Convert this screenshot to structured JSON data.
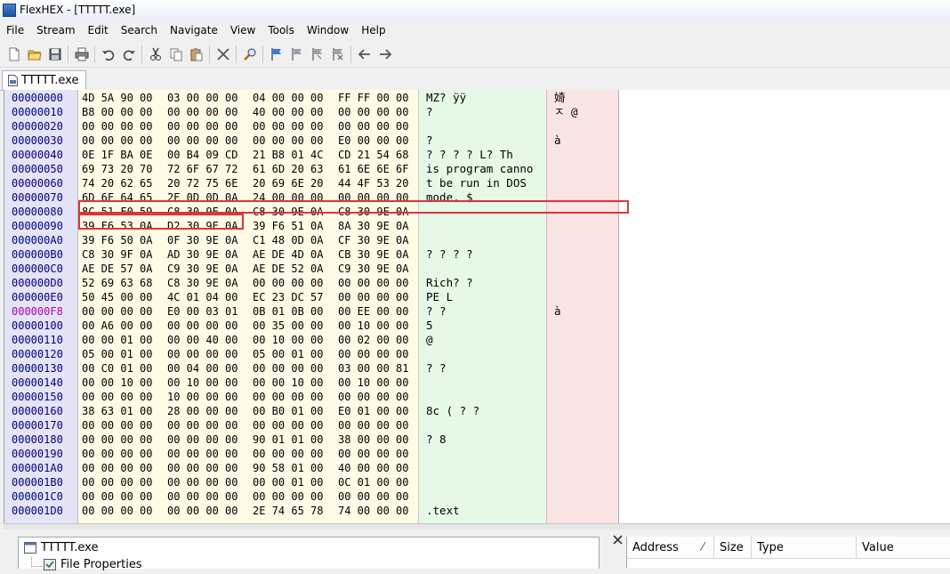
{
  "window": {
    "title": "FlexHEX - [TTTTT.exe]"
  },
  "menu": [
    "File",
    "Stream",
    "Edit",
    "Search",
    "Navigate",
    "View",
    "Tools",
    "Window",
    "Help"
  ],
  "toolbar_icons": [
    "new-file-icon",
    "open-folder-icon",
    "save-icon",
    "sep",
    "print-icon",
    "sep",
    "undo-icon",
    "redo-icon",
    "sep",
    "cut-icon",
    "copy-icon",
    "paste-icon",
    "sep",
    "delete-icon",
    "sep",
    "find-icon",
    "sep",
    "bookmark-flag-icon",
    "bookmark-flag-gray-icon",
    "bookmark-flag-gray-2-icon",
    "bookmark-flag-clear-icon",
    "sep",
    "nav-back-icon",
    "nav-forward-icon"
  ],
  "document_tab": {
    "label": "TTTTT.exe"
  },
  "hex_view": {
    "highlighted_offset": "000000F8",
    "rows": [
      {
        "offset": "00000000",
        "hex": [
          "4D 5A 90 00",
          "03 00 00 00",
          "04 00 00 00",
          "FF FF 00 00"
        ],
        "ascii": "MZ?         ÿÿ",
        "unicode": "婍"
      },
      {
        "offset": "00000010",
        "hex": [
          "B8 00 00 00",
          "00 00 00 00",
          "40 00 00 00",
          "00 00 00 00"
        ],
        "ascii": "?",
        "unicode": "ﾸ    @"
      },
      {
        "offset": "00000020",
        "hex": [
          "00 00 00 00",
          "00 00 00 00",
          "00 00 00 00",
          "00 00 00 00"
        ],
        "ascii": "",
        "unicode": ""
      },
      {
        "offset": "00000030",
        "hex": [
          "00 00 00 00",
          "00 00 00 00",
          "00 00 00 00",
          "E0 00 00 00"
        ],
        "ascii": "            ?",
        "unicode": "      à"
      },
      {
        "offset": "00000040",
        "hex": [
          "0E 1F BA 0E",
          "00 B4 09 CD",
          "21 B8 01 4C",
          "CD 21 54 68"
        ],
        "ascii": "  ? ? ? ? L? Th",
        "unicode": ""
      },
      {
        "offset": "00000050",
        "hex": [
          "69 73 20 70",
          "72 6F 67 72",
          "61 6D 20 63",
          "61 6E 6E 6F"
        ],
        "ascii": "is program canno",
        "unicode": ""
      },
      {
        "offset": "00000060",
        "hex": [
          "74 20 62 65",
          "20 72 75 6E",
          "20 69 6E 20",
          "44 4F 53 20"
        ],
        "ascii": "t be run in DOS",
        "unicode": ""
      },
      {
        "offset": "00000070",
        "hex": [
          "6D 6F 64 65",
          "2E 0D 0D 0A",
          "24 00 00 00",
          "00 00 00 00"
        ],
        "ascii": "mode.   $",
        "unicode": ""
      },
      {
        "offset": "00000080",
        "hex": [
          "8C 51 F0 59",
          "C8 30 9E 0A",
          "C8 30 9E 0A",
          "C8 30 9E 0A"
        ],
        "ascii": "",
        "unicode": ""
      },
      {
        "offset": "00000090",
        "hex": [
          "39 F6 53 0A",
          "D2 30 9E 0A",
          "39 F6 51 0A",
          "8A 30 9E 0A"
        ],
        "ascii": "",
        "unicode": ""
      },
      {
        "offset": "000000A0",
        "hex": [
          "39 F6 50 0A",
          "0F 30 9E 0A",
          "C1 48 0D 0A",
          "CF 30 9E 0A"
        ],
        "ascii": "",
        "unicode": ""
      },
      {
        "offset": "000000B0",
        "hex": [
          "C8 30 9F 0A",
          "AD 30 9E 0A",
          "AE DE 4D 0A",
          "CB 30 9E 0A"
        ],
        "ascii": "? ? ? ?",
        "unicode": ""
      },
      {
        "offset": "000000C0",
        "hex": [
          "AE DE 57 0A",
          "C9 30 9E 0A",
          "AE DE 52 0A",
          "C9 30 9E 0A"
        ],
        "ascii": "",
        "unicode": ""
      },
      {
        "offset": "000000D0",
        "hex": [
          "52 69 63 68",
          "C8 30 9E 0A",
          "00 00 00 00",
          "00 00 00 00"
        ],
        "ascii": "Rich? ?",
        "unicode": ""
      },
      {
        "offset": "000000E0",
        "hex": [
          "50 45 00 00",
          "4C 01 04 00",
          "EC 23 DC 57",
          "00 00 00 00"
        ],
        "ascii": "PE  L",
        "unicode": ""
      },
      {
        "offset": "000000F8",
        "hex": [
          "00 00 00 00",
          "E0 00 03 01",
          "0B 01 0B 00",
          "00 EE 00 00"
        ],
        "ascii": "     ?        ?",
        "unicode": "   à"
      },
      {
        "offset": "00000100",
        "hex": [
          "00 A6 00 00",
          "00 00 00 00",
          "00 35 00 00",
          "00 10 00 00"
        ],
        "ascii": "            5",
        "unicode": ""
      },
      {
        "offset": "00000110",
        "hex": [
          "00 00 01 00",
          "00 00 40 00",
          "00 10 00 00",
          "00 02 00 00"
        ],
        "ascii": "      @",
        "unicode": ""
      },
      {
        "offset": "00000120",
        "hex": [
          "05 00 01 00",
          "00 00 00 00",
          "05 00 01 00",
          "00 00 00 00"
        ],
        "ascii": "",
        "unicode": ""
      },
      {
        "offset": "00000130",
        "hex": [
          "00 C0 01 00",
          "00 04 00 00",
          "00 00 00 00",
          "03 00 00 81"
        ],
        "ascii": " ?             ?",
        "unicode": ""
      },
      {
        "offset": "00000140",
        "hex": [
          "00 00 10 00",
          "00 10 00 00",
          "00 00 10 00",
          "00 10 00 00"
        ],
        "ascii": "",
        "unicode": ""
      },
      {
        "offset": "00000150",
        "hex": [
          "00 00 00 00",
          "10 00 00 00",
          "00 00 00 00",
          "00 00 00 00"
        ],
        "ascii": "",
        "unicode": ""
      },
      {
        "offset": "00000160",
        "hex": [
          "38 63 01 00",
          "28 00 00 00",
          "00 B0 01 00",
          "E0 01 00 00"
        ],
        "ascii": "8c  (    ?  ?",
        "unicode": ""
      },
      {
        "offset": "00000170",
        "hex": [
          "00 00 00 00",
          "00 00 00 00",
          "00 00 00 00",
          "00 00 00 00"
        ],
        "ascii": "",
        "unicode": ""
      },
      {
        "offset": "00000180",
        "hex": [
          "00 00 00 00",
          "00 00 00 00",
          "90 01 01 00",
          "38 00 00 00"
        ],
        "ascii": "        ?   8",
        "unicode": ""
      },
      {
        "offset": "00000190",
        "hex": [
          "00 00 00 00",
          "00 00 00 00",
          "00 00 00 00",
          "00 00 00 00"
        ],
        "ascii": "",
        "unicode": ""
      },
      {
        "offset": "000001A0",
        "hex": [
          "00 00 00 00",
          "00 00 00 00",
          "90 58 01 00",
          "40 00 00 00"
        ],
        "ascii": "",
        "unicode": ""
      },
      {
        "offset": "000001B0",
        "hex": [
          "00 00 00 00",
          "00 00 00 00",
          "00 00 01 00",
          "0C 01 00 00"
        ],
        "ascii": "",
        "unicode": ""
      },
      {
        "offset": "000001C0",
        "hex": [
          "00 00 00 00",
          "00 00 00 00",
          "00 00 00 00",
          "00 00 00 00"
        ],
        "ascii": "",
        "unicode": ""
      },
      {
        "offset": "000001D0",
        "hex": [
          "00 00 00 00",
          "00 00 00 00",
          "2E 74 65 78",
          "74 00 00 00"
        ],
        "ascii": "        .text",
        "unicode": ""
      }
    ]
  },
  "bottom_left_panel": {
    "tree_root": "TTTTT.exe",
    "tree_child": "File Properties"
  },
  "properties_panel": {
    "columns": [
      "Address",
      "Size",
      "Type",
      "Value"
    ]
  }
}
